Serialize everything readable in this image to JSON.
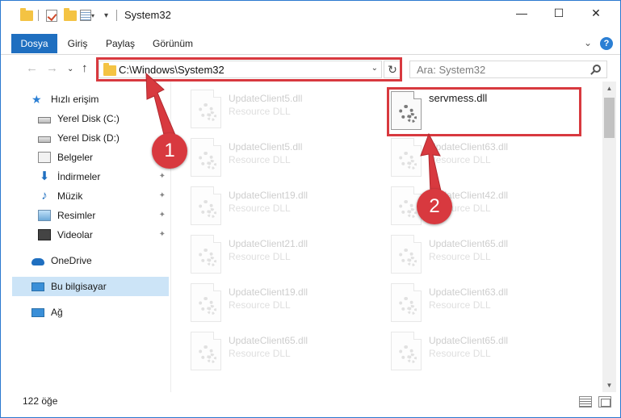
{
  "window": {
    "title": "System32",
    "controls": {
      "minimize": "—",
      "maximize": "☐",
      "close": "✕"
    }
  },
  "ribbon": {
    "tabs": [
      {
        "label": "Dosya",
        "active": true
      },
      {
        "label": "Giriş",
        "active": false
      },
      {
        "label": "Paylaş",
        "active": false
      },
      {
        "label": "Görünüm",
        "active": false
      }
    ],
    "expand_icon": "⌄",
    "help_icon": "?"
  },
  "navigation": {
    "back": "←",
    "forward": "→",
    "recent": "⌄",
    "up": "↑",
    "address": "C:\\Windows\\System32",
    "address_dropdown": "⌄",
    "refresh": "↻",
    "search_placeholder": "Ara: System32"
  },
  "sidebar": {
    "items": [
      {
        "label": "Hızlı erişim",
        "icon": "star-icon",
        "pinned": false
      },
      {
        "label": "Yerel Disk (C:)",
        "icon": "drive-icon",
        "pinned": false
      },
      {
        "label": "Yerel Disk (D:)",
        "icon": "drive-icon",
        "pinned": false
      },
      {
        "label": "Belgeler",
        "icon": "documents-icon",
        "pinned": false
      },
      {
        "label": "İndirmeler",
        "icon": "download-icon",
        "pinned": true
      },
      {
        "label": "Müzik",
        "icon": "music-icon",
        "pinned": true
      },
      {
        "label": "Resimler",
        "icon": "pictures-icon",
        "pinned": true
      },
      {
        "label": "Videolar",
        "icon": "videos-icon",
        "pinned": true
      },
      {
        "label": "OneDrive",
        "icon": "onedrive-icon",
        "pinned": false
      },
      {
        "label": "Bu bilgisayar",
        "icon": "computer-icon",
        "pinned": false,
        "selected": true
      },
      {
        "label": "Ağ",
        "icon": "network-icon",
        "pinned": false
      }
    ],
    "pin_glyph": "📌"
  },
  "files": {
    "left_column": [
      {
        "name": "UpdateClient5.dll",
        "type": "Resource DLL"
      },
      {
        "name": "UpdateClient5.dll",
        "type": "Resource DLL"
      },
      {
        "name": "UpdateClient19.dll",
        "type": "Resource DLL"
      },
      {
        "name": "UpdateClient21.dll",
        "type": "Resource DLL"
      },
      {
        "name": "UpdateClient19.dll",
        "type": "Resource DLL"
      },
      {
        "name": "UpdateClient65.dll",
        "type": "Resource DLL"
      }
    ],
    "right_column": [
      {
        "name": "servmess.dll",
        "type": ""
      },
      {
        "name": "UpdateClient63.dll",
        "type": "Resource DLL"
      },
      {
        "name": "UpdateClient42.dll",
        "type": "Resource DLL"
      },
      {
        "name": "UpdateClient65.dll",
        "type": "Resource DLL"
      },
      {
        "name": "UpdateClient63.dll",
        "type": "Resource DLL"
      },
      {
        "name": "UpdateClient65.dll",
        "type": "Resource DLL"
      }
    ]
  },
  "status": {
    "item_count": "122 öğe"
  },
  "callouts": [
    {
      "number": "1"
    },
    {
      "number": "2"
    }
  ],
  "colors": {
    "accent": "#1f6fc0",
    "highlight": "#d8393f",
    "selected": "#cce4f7"
  }
}
